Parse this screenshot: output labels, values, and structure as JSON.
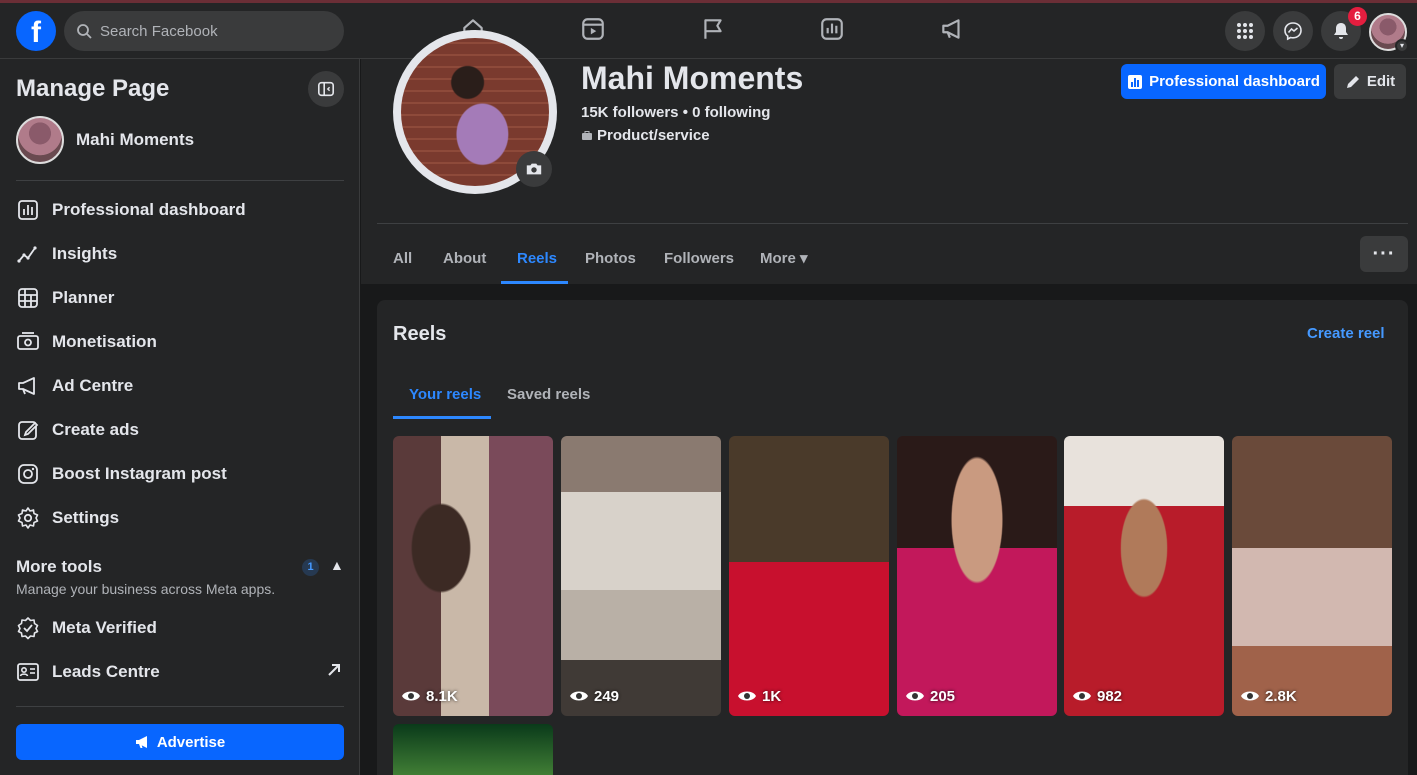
{
  "topbar": {
    "logo": "f",
    "search_placeholder": "Search Facebook",
    "nav_icons": [
      "home-icon",
      "video-icon",
      "flag-icon",
      "analytics-icon",
      "megaphone-icon"
    ],
    "notification_count": "6"
  },
  "sidebar": {
    "title": "Manage Page",
    "page_name": "Mahi Moments",
    "items": [
      {
        "label": "Professional dashboard",
        "icon": "dashboard-icon"
      },
      {
        "label": "Insights",
        "icon": "insights-icon"
      },
      {
        "label": "Planner",
        "icon": "planner-icon"
      },
      {
        "label": "Monetisation",
        "icon": "monetisation-icon"
      },
      {
        "label": "Ad Centre",
        "icon": "megaphone-icon"
      },
      {
        "label": "Create ads",
        "icon": "edit-icon"
      },
      {
        "label": "Boost Instagram post",
        "icon": "instagram-icon"
      },
      {
        "label": "Settings",
        "icon": "gear-icon"
      }
    ],
    "more_tools": {
      "title": "More tools",
      "subtitle": "Manage your business across Meta apps.",
      "badge": "1"
    },
    "tools": [
      {
        "label": "Meta Verified",
        "icon": "verified-icon"
      },
      {
        "label": "Leads Centre",
        "icon": "leads-icon"
      }
    ],
    "advertise_label": "Advertise"
  },
  "profile": {
    "name": "Mahi Moments",
    "stats": "15K followers • 0 following",
    "category": "Product/service",
    "dashboard_button": "Professional dashboard",
    "edit_button": "Edit"
  },
  "tabs": [
    "All",
    "About",
    "Reels",
    "Photos",
    "Followers",
    "More ▾"
  ],
  "active_tab": "Reels",
  "reels": {
    "title": "Reels",
    "create_label": "Create reel",
    "subtabs": [
      "Your reels",
      "Saved reels"
    ],
    "active_subtab": "Your reels",
    "items": [
      {
        "views": "8.1K"
      },
      {
        "views": "249"
      },
      {
        "views": "1K"
      },
      {
        "views": "205"
      },
      {
        "views": "982"
      },
      {
        "views": "2.8K"
      }
    ]
  },
  "colors": {
    "accent": "#0866ff",
    "link": "#2d88ff",
    "background": "#18191a",
    "surface": "#242526"
  }
}
